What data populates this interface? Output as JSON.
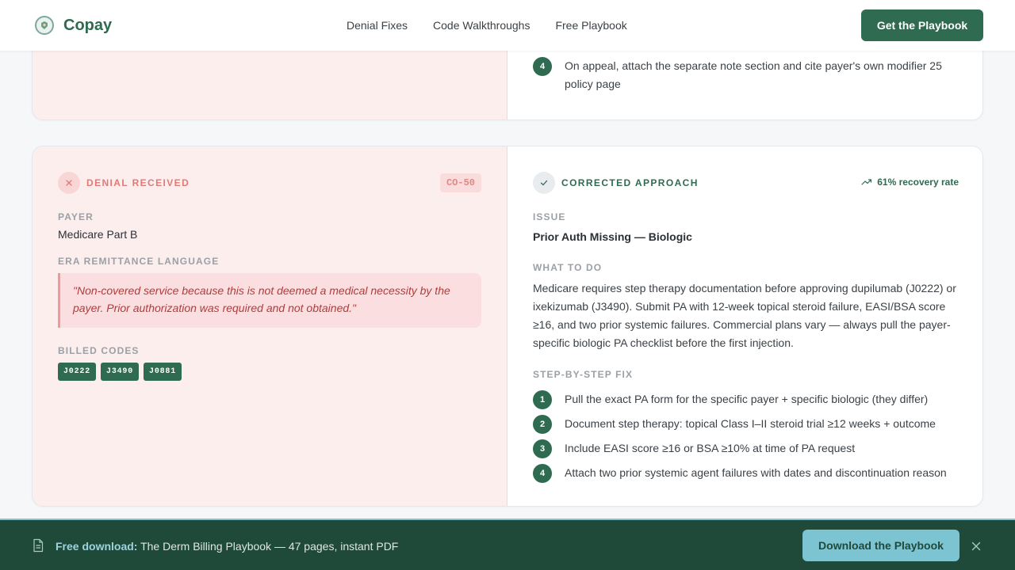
{
  "nav": {
    "brand": "Copay",
    "links": [
      "Denial Fixes",
      "Code Walkthroughs",
      "Free Playbook"
    ],
    "cta": "Get the Playbook"
  },
  "prev_card": {
    "steps": [
      {
        "num": "4",
        "text": "On appeal, attach the separate note section and cite payer's own modifier 25 policy page"
      }
    ]
  },
  "card": {
    "denial": {
      "label": "DENIAL RECEIVED",
      "code": "CO-50",
      "payer_label": "PAYER",
      "payer": "Medicare Part B",
      "era_label": "ERA REMITTANCE LANGUAGE",
      "era_text": "\"Non-covered service because this is not deemed a medical necessity by the payer. Prior authorization was required and not obtained.\"",
      "codes_label": "BILLED CODES",
      "codes": [
        "J0222",
        "J3490",
        "J0881"
      ]
    },
    "corrected": {
      "label": "CORRECTED APPROACH",
      "recovery": "61% recovery rate",
      "issue_label": "ISSUE",
      "issue": "Prior Auth Missing — Biologic",
      "todo_label": "WHAT TO DO",
      "todo": "Medicare requires step therapy documentation before approving dupilumab (J0222) or ixekizumab (J3490). Submit PA with 12-week topical steroid failure, EASI/BSA score ≥16, and two prior systemic failures. Commercial plans vary — always pull the payer-specific biologic PA checklist before the first injection.",
      "steps_label": "STEP-BY-STEP FIX",
      "steps": [
        {
          "num": "1",
          "text": "Pull the exact PA form for the specific payer + specific biologic (they differ)"
        },
        {
          "num": "2",
          "text": "Document step therapy: topical Class I–II steroid trial ≥12 weeks + outcome"
        },
        {
          "num": "3",
          "text": "Include EASI score ≥16 or BSA ≥10% at time of PA request"
        },
        {
          "num": "4",
          "text": "Attach two prior systemic agent failures with dates and discontinuation reason"
        }
      ]
    }
  },
  "download_bar": {
    "bold": "Free download:",
    "text": "The Derm Billing Playbook — 47 pages, instant PDF",
    "button": "Download the Playbook"
  }
}
